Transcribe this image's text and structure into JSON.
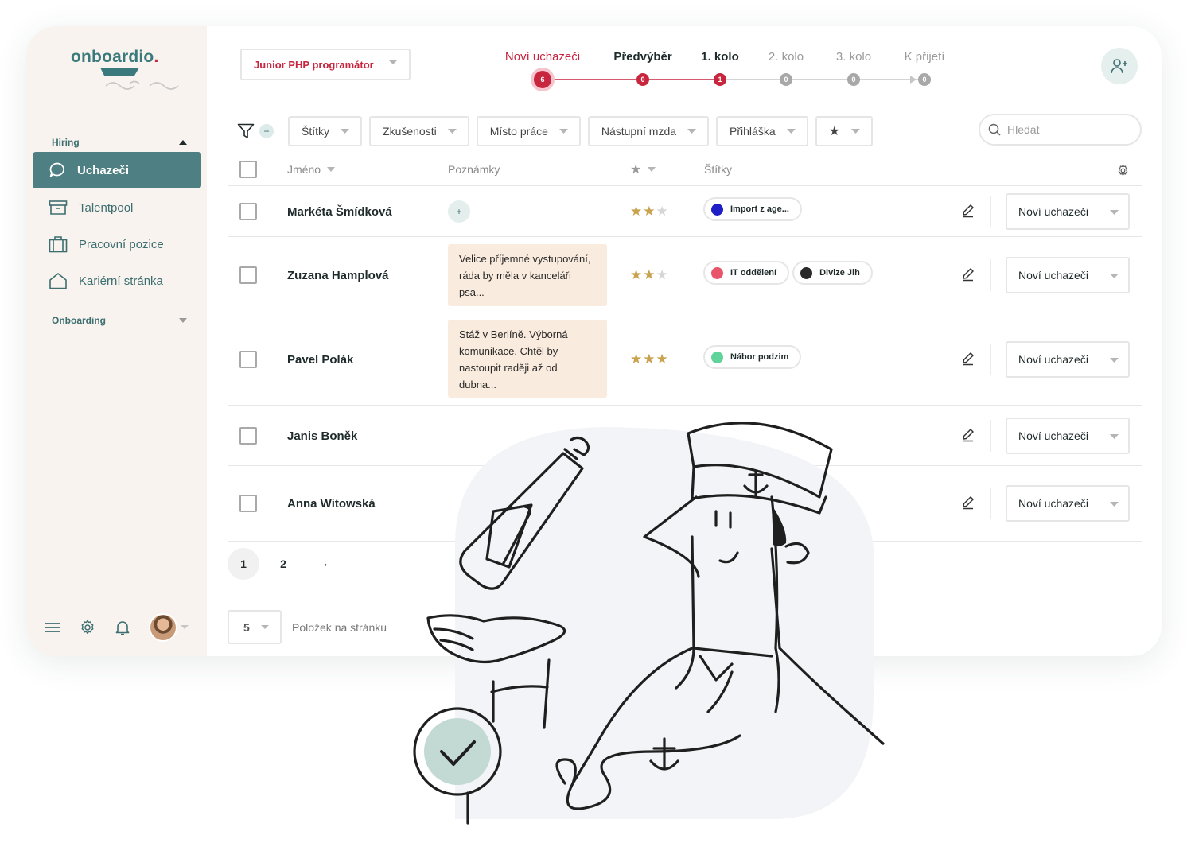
{
  "app": {
    "brand": "onboardio",
    "brand_dot": "."
  },
  "sidebar": {
    "hiring_label": "Hiring",
    "onboarding_label": "Onboarding",
    "items": [
      {
        "label": "Uchazeči",
        "icon": "chat-bubble-icon",
        "active": true
      },
      {
        "label": "Talentpool",
        "icon": "archive-box-icon",
        "active": false
      },
      {
        "label": "Pracovní pozice",
        "icon": "briefcase-icon",
        "active": false
      },
      {
        "label": "Kariérní stránka",
        "icon": "home-icon",
        "active": false
      }
    ],
    "bottom_icons": [
      "menu-icon",
      "gear-icon",
      "bell-icon",
      "avatar"
    ]
  },
  "header": {
    "job_position": "Junior PHP programátor",
    "pipeline": [
      {
        "label": "Noví uchazeči",
        "count": "6",
        "state": "current"
      },
      {
        "label": "Předvýběr",
        "count": "0",
        "state": "done"
      },
      {
        "label": "1. kolo",
        "count": "1",
        "state": "done"
      },
      {
        "label": "2. kolo",
        "count": "0",
        "state": "todo"
      },
      {
        "label": "3. kolo",
        "count": "0",
        "state": "todo"
      },
      {
        "label": "K přijetí",
        "count": "0",
        "state": "todo"
      }
    ]
  },
  "filters": {
    "minus": "−",
    "items": [
      "Štítky",
      "Zkušenosti",
      "Místo práce",
      "Nástupní mzda",
      "Přihláška",
      "★"
    ],
    "search_placeholder": "Hledat"
  },
  "table": {
    "columns": {
      "name": "Jméno",
      "notes": "Poznámky",
      "rating": "★",
      "tags": "Štítky"
    },
    "rows": [
      {
        "name": "Markéta Šmídková",
        "note": "",
        "rating": 2,
        "tags": [
          {
            "label": "Import z age...",
            "color": "#1f1fc8"
          }
        ],
        "status": "Noví uchazeči"
      },
      {
        "name": "Zuzana Hamplová",
        "note": "Velice příjemné vystupování, ráda by měla v kanceláři psa...",
        "rating": 2,
        "tags": [
          {
            "label": "IT oddělení",
            "color": "#e8546a"
          },
          {
            "label": "Divize Jih",
            "color": "#2a2a2a"
          }
        ],
        "status": "Noví uchazeči"
      },
      {
        "name": "Pavel Polák",
        "note": "Stáž v Berlíně. Výborná komunikace. Chtěl by nastoupit raději až od dubna...",
        "rating": 3,
        "tags": [
          {
            "label": "Nábor podzim",
            "color": "#5fd39a"
          }
        ],
        "status": "Noví uchazeči"
      },
      {
        "name": "Janis Boněk",
        "note": "",
        "rating": 0,
        "tags": [],
        "status": "Noví uchazeči"
      },
      {
        "name": "Anna Witowská",
        "note": "",
        "rating": 0,
        "tags": [],
        "status": "Noví uchazeči"
      }
    ],
    "note_add": "+"
  },
  "pagination": {
    "pages": [
      "1",
      "2"
    ],
    "current": "1",
    "next": "→",
    "per_page": "5",
    "per_page_label": "Položek na stránku"
  },
  "colors": {
    "accent_red": "#c8253f",
    "teal": "#4e7f82",
    "sidebar_bg": "#f8f3ee",
    "note_bg": "#f9ebdd",
    "star": "#c9a24e"
  }
}
